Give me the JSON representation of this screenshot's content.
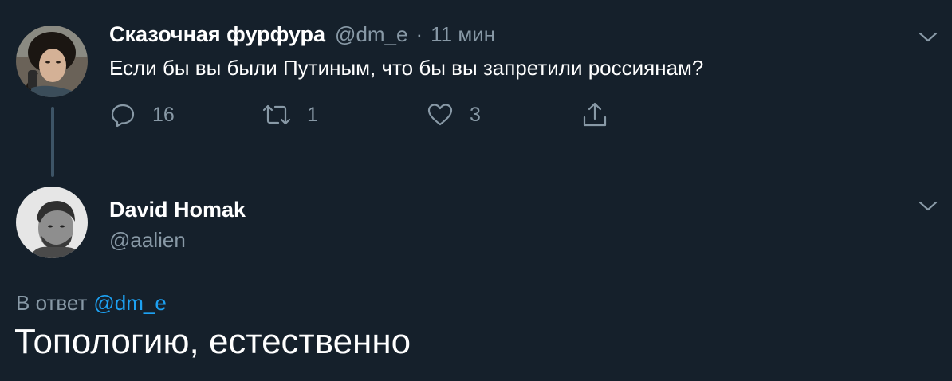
{
  "colors": {
    "background": "#15202b",
    "text_primary": "#ffffff",
    "text_secondary": "#8899a6",
    "link": "#1da1f2",
    "thread_line": "#3d5466"
  },
  "tweet1": {
    "author_name": "Сказочная фурфура",
    "handle": "@dm_e",
    "separator": "·",
    "time": "11 мин",
    "text": "Если бы вы были Путиным, что бы вы запретили россиянам?",
    "actions": {
      "reply_icon": "reply-icon",
      "reply_count": "16",
      "retweet_icon": "retweet-icon",
      "retweet_count": "1",
      "like_icon": "heart-icon",
      "like_count": "3",
      "share_icon": "share-icon"
    },
    "menu_icon": "chevron-down-icon"
  },
  "tweet2": {
    "author_name": "David Homak",
    "handle": "@aalien",
    "menu_icon": "chevron-down-icon",
    "reply_prefix": "В ответ",
    "reply_to": "@dm_e",
    "text": "Топологию, естественно"
  }
}
